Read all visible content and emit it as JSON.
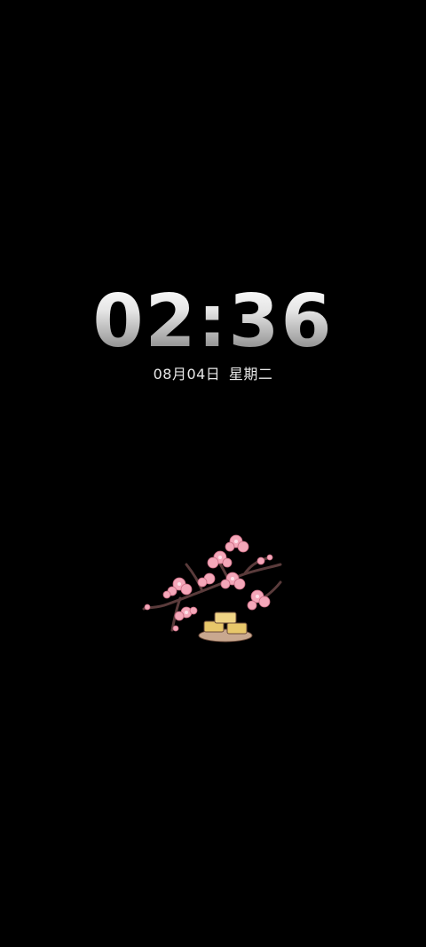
{
  "lockscreen": {
    "time": "02:36",
    "date": "08月04日",
    "weekday": "星期二"
  },
  "decoration": {
    "icon": "cherry-blossom-branch-with-cakes",
    "blossom_color": "#f4a7b9",
    "branch_color": "#5a3b3b",
    "cake_color": "#e8c76a"
  }
}
